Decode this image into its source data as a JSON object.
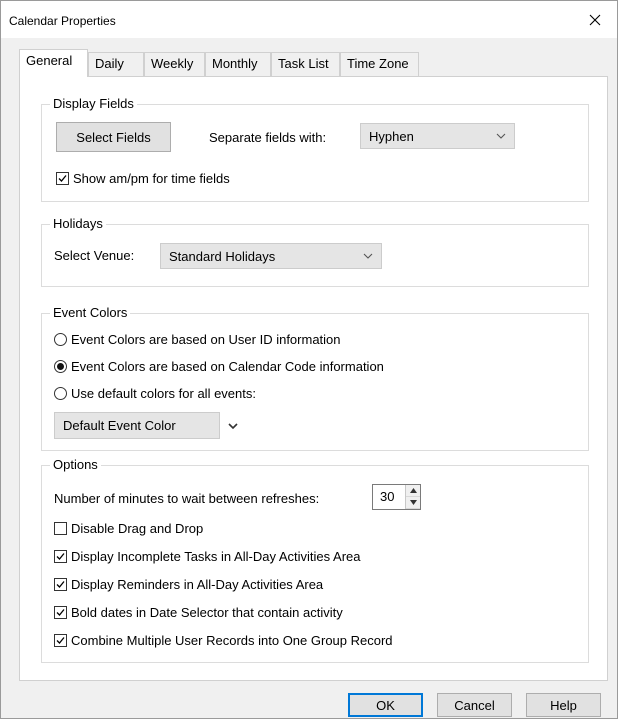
{
  "window": {
    "title": "Calendar Properties",
    "close_glyph": "✕"
  },
  "tabs": [
    {
      "label": "General",
      "active": true
    },
    {
      "label": "Daily",
      "active": false
    },
    {
      "label": "Weekly",
      "active": false
    },
    {
      "label": "Monthly",
      "active": false
    },
    {
      "label": "Task List",
      "active": false
    },
    {
      "label": "Time Zone",
      "active": false
    }
  ],
  "display_fields": {
    "legend": "Display Fields",
    "select_fields_label": "Select Fields",
    "separate_label": "Separate fields with:",
    "separator_value": "Hyphen",
    "show_ampm_label": "Show am/pm for time fields",
    "show_ampm_checked": true
  },
  "holidays": {
    "legend": "Holidays",
    "venue_label": "Select Venue:",
    "venue_value": "Standard Holidays"
  },
  "event_colors": {
    "legend": "Event Colors",
    "options": [
      {
        "label": "Event Colors are based on User ID information",
        "selected": false
      },
      {
        "label": "Event Colors are based on Calendar Code information",
        "selected": true
      },
      {
        "label": "Use default colors for all events:",
        "selected": false
      }
    ],
    "default_color_value": "Default Event Color"
  },
  "options": {
    "legend": "Options",
    "refresh_label": "Number of minutes to wait between refreshes:",
    "refresh_value": "30",
    "checkboxes": [
      {
        "label": "Disable Drag and Drop",
        "checked": false
      },
      {
        "label": "Display Incomplete Tasks in All-Day Activities Area",
        "checked": true
      },
      {
        "label": "Display Reminders in All-Day Activities Area",
        "checked": true
      },
      {
        "label": "Bold dates in Date Selector that contain activity",
        "checked": true
      },
      {
        "label": "Combine Multiple User Records into One Group Record",
        "checked": true
      }
    ]
  },
  "footer": {
    "ok_label": "OK",
    "cancel_label": "Cancel",
    "help_label": "Help"
  },
  "colors": {
    "dialog_bg": "#f0f0f0",
    "panel_bg": "#ffffff",
    "accent": "#0078d7"
  }
}
